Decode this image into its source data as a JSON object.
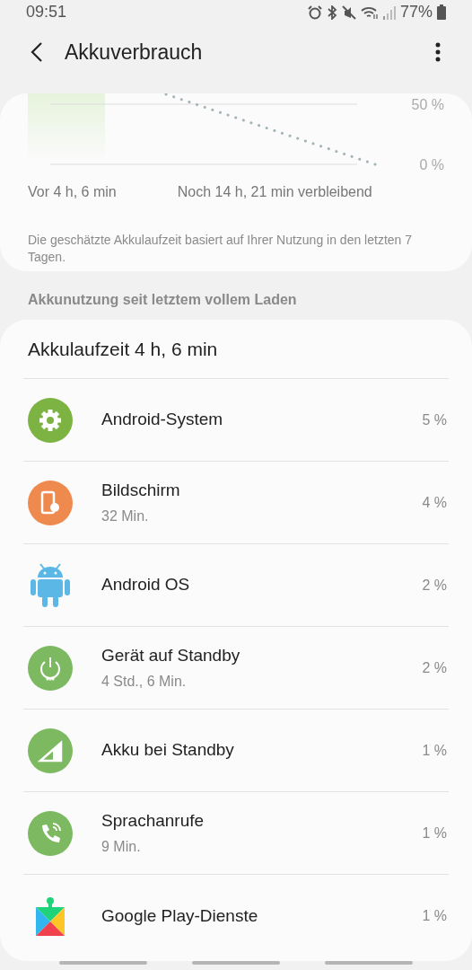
{
  "status_bar": {
    "time": "09:51",
    "battery": "77%"
  },
  "header": {
    "title": "Akkuverbrauch"
  },
  "chart_card": {
    "axis_labels": [
      "50 %",
      "0 %"
    ],
    "since_label": "Vor 4 h, 6 min",
    "remaining_label": "Noch 14 h, 21 min verbleibend",
    "note": "Die geschätzte Akkulaufzeit basiert auf Ihrer Nutzung in den letzten 7 Tagen."
  },
  "section_title": "Akkunutzung seit letztem vollem Laden",
  "usage": {
    "title": "Akkulaufzeit 4 h, 6 min",
    "items": [
      {
        "kind": "gear",
        "name": "Android-System",
        "percent": "5 %"
      },
      {
        "kind": "screen",
        "name": "Bildschirm",
        "detail": "32 Min.",
        "percent": "4 %"
      },
      {
        "kind": "android",
        "name": "Android OS",
        "percent": "2 %"
      },
      {
        "kind": "power",
        "name": "Gerät auf Standby",
        "detail": "4 Std., 6 Min.",
        "percent": "2 %"
      },
      {
        "kind": "signal",
        "name": "Akku bei Standby",
        "percent": "1 %"
      },
      {
        "kind": "phone",
        "name": "Sprachanrufe",
        "detail": "9 Min.",
        "percent": "1 %"
      },
      {
        "kind": "puzzle",
        "name": "Google Play-Dienste",
        "percent": "1 %"
      }
    ]
  }
}
